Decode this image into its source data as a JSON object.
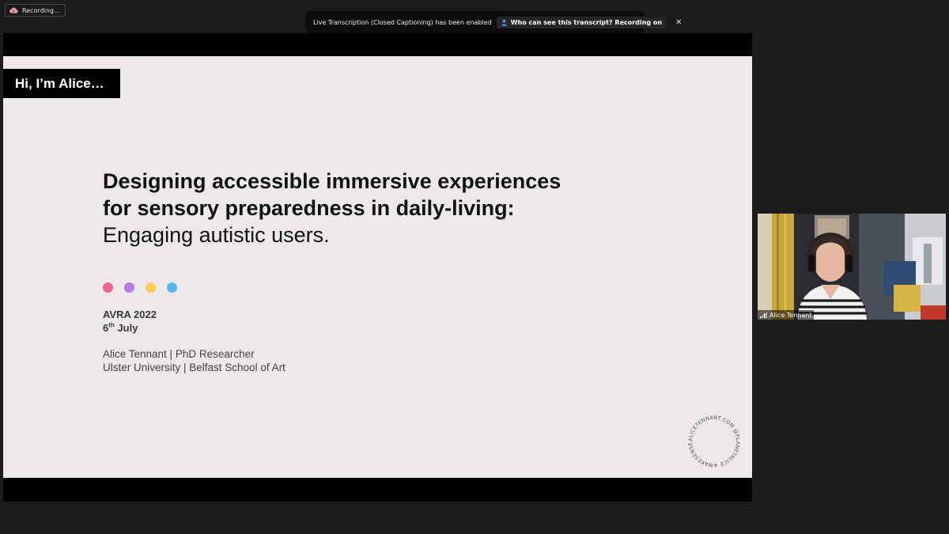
{
  "recording": {
    "label": "Recording..."
  },
  "transcription_banner": {
    "message": "Live Transcription (Closed Captioning) has been enabled",
    "button_label": "Who can see this transcript? Recording on",
    "close_glyph": "✕"
  },
  "slide": {
    "intro": "Hi, I’m Alice…",
    "title_line1": "Designing accessible immersive experiences",
    "title_line2": "for sensory preparedness in daily-living:",
    "title_line3": "Engaging autistic users.",
    "dot_colors": [
      "#ee6590",
      "#b27bf0",
      "#f5cf55",
      "#56b6f1"
    ],
    "event": "AVRA 2022",
    "date_day": "6",
    "date_suffix": "th",
    "date_month": "July",
    "author_line1": "Alice Tennant | PhD Researcher",
    "author_line2": "Ulster University | Belfast School of Art",
    "ring_text": "ALICETENNANT.COM  @PLANETALICE  #MAKESENSE"
  },
  "participant": {
    "name": "Alice Tennant"
  },
  "icons": {
    "recording": "cloud-record-icon",
    "transcript": "person-icon",
    "close": "close-icon",
    "signal": "signal-bars-icon"
  }
}
